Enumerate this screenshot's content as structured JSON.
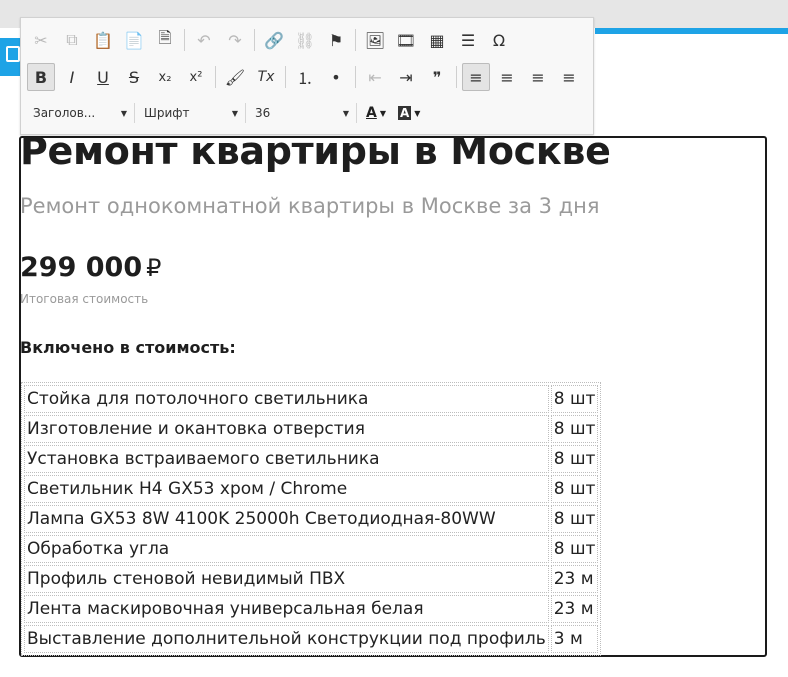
{
  "toolbar": {
    "row1": [
      {
        "name": "cut-icon",
        "glyph": "✂",
        "disabled": true
      },
      {
        "name": "copy-icon",
        "glyph": "⧉",
        "disabled": true
      },
      {
        "name": "paste-icon",
        "glyph": "📋",
        "disabled": false
      },
      {
        "name": "paste-text-icon",
        "glyph": "📄",
        "disabled": false
      },
      {
        "name": "paste-word-icon",
        "glyph": "🗎",
        "disabled": false
      },
      {
        "name": "undo-icon",
        "glyph": "↶",
        "disabled": true
      },
      {
        "name": "redo-icon",
        "glyph": "↷",
        "disabled": true
      },
      {
        "name": "link-icon",
        "glyph": "🔗",
        "disabled": false
      },
      {
        "name": "unlink-icon",
        "glyph": "⛓",
        "disabled": true
      },
      {
        "name": "anchor-flag-icon",
        "glyph": "⚑",
        "disabled": false
      },
      {
        "name": "image-icon",
        "glyph": "🖼",
        "disabled": false
      },
      {
        "name": "video-icon",
        "glyph": "🎞",
        "disabled": false
      },
      {
        "name": "table-icon",
        "glyph": "▦",
        "disabled": false
      },
      {
        "name": "horizontal-line-icon",
        "glyph": "☰",
        "disabled": false
      },
      {
        "name": "special-char-icon",
        "glyph": "Ω",
        "disabled": false
      }
    ],
    "row2": [
      {
        "name": "bold-icon",
        "glyph": "B",
        "active": true
      },
      {
        "name": "italic-icon",
        "glyph": "I"
      },
      {
        "name": "underline-icon",
        "glyph": "U"
      },
      {
        "name": "strikethrough-icon",
        "glyph": "S"
      },
      {
        "name": "subscript-icon",
        "glyph": "x₂"
      },
      {
        "name": "superscript-icon",
        "glyph": "x²"
      },
      {
        "name": "format-paint-icon",
        "glyph": "🖌"
      },
      {
        "name": "clear-format-icon",
        "glyph": "Tx"
      },
      {
        "name": "numbered-list-icon",
        "glyph": "⒈"
      },
      {
        "name": "bulleted-list-icon",
        "glyph": "•"
      },
      {
        "name": "outdent-icon",
        "glyph": "⇤",
        "disabled": true
      },
      {
        "name": "indent-icon",
        "glyph": "⇥"
      },
      {
        "name": "blockquote-icon",
        "glyph": "❞"
      },
      {
        "name": "align-left-icon",
        "glyph": "≡",
        "active": true
      },
      {
        "name": "align-center-icon",
        "glyph": "≡"
      },
      {
        "name": "align-right-icon",
        "glyph": "≡"
      },
      {
        "name": "align-justify-icon",
        "glyph": "≡"
      }
    ],
    "format_label": "Заголов...",
    "font_label": "Шрифт",
    "size_label": "36",
    "text_color_glyph": "A",
    "bg_color_glyph": "A"
  },
  "page": {
    "title": "Ремонт квартиры в Москве",
    "subtitle": "Ремонт однокомнатной квартиры в Москве за 3 дня",
    "price": "299 000",
    "currency": "₽",
    "price_note": "Итоговая стоимость",
    "included_heading": "Включено в стоимость:"
  },
  "items": [
    {
      "name": "Стойка для потолочного светильника",
      "qty": "8 шт"
    },
    {
      "name": "Изготовление и окантовка отверстия",
      "qty": "8 шт"
    },
    {
      "name": "Установка встраиваемого светильника",
      "qty": "8 шт"
    },
    {
      "name": "Светильник H4 GX53 хром / Chrome",
      "qty": "8 шт"
    },
    {
      "name": "Лампа GX53 8W 4100K 25000h Светодиодная-80WW",
      "qty": "8 шт"
    },
    {
      "name": "Обработка угла",
      "qty": "8 шт"
    },
    {
      "name": "Профиль стеновой невидимый ПВХ",
      "qty": "23 м"
    },
    {
      "name": "Лента маскировочная универсальная белая",
      "qty": "23 м"
    },
    {
      "name": "Выставление дополнительной конструкции под профиль",
      "qty": "3 м"
    }
  ],
  "colors": {
    "accent": "#1ea3e6",
    "border": "#1a1a1a",
    "muted": "#9a9a9a"
  }
}
